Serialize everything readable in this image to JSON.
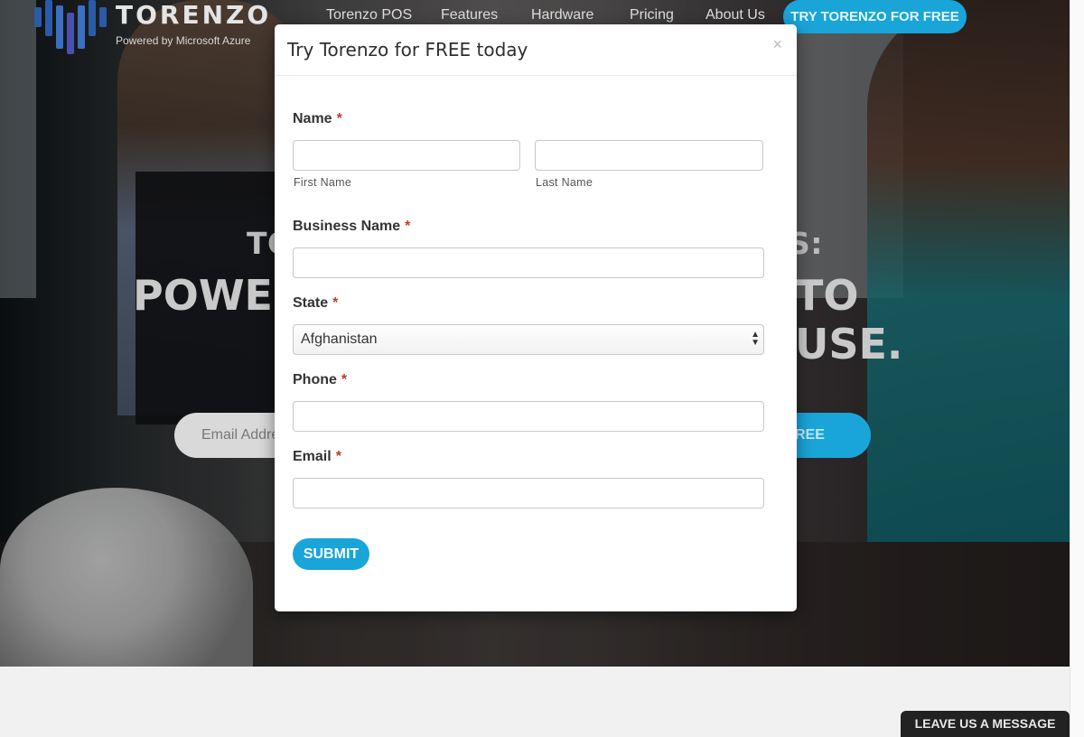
{
  "brand": {
    "name": "TORENZO",
    "tagline": "Powered by Microsoft Azure"
  },
  "nav": {
    "items": [
      "Torenzo POS",
      "Features",
      "Hardware",
      "Pricing",
      "About Us"
    ],
    "cta": "TRY TORENZO FOR FREE"
  },
  "hero": {
    "line1_left": "TO",
    "line1_right": "S:",
    "line2_left": "POWER",
    "line2_right": "TO USE.",
    "email_placeholder": "Email Addre",
    "button_fragment": "REE"
  },
  "modal": {
    "title": "Try Torenzo for FREE today",
    "close": "×",
    "name_label": "Name",
    "first_name_sub": "First Name",
    "last_name_sub": "Last Name",
    "business_label": "Business Name",
    "state_label": "State",
    "state_value": "Afghanistan",
    "phone_label": "Phone",
    "email_label": "Email",
    "required_marker": "*",
    "submit": "SUBMIT"
  },
  "chat": {
    "label": "LEAVE US A MESSAGE"
  },
  "colors": {
    "accent": "#1aa5d9",
    "required": "#c0392b"
  }
}
